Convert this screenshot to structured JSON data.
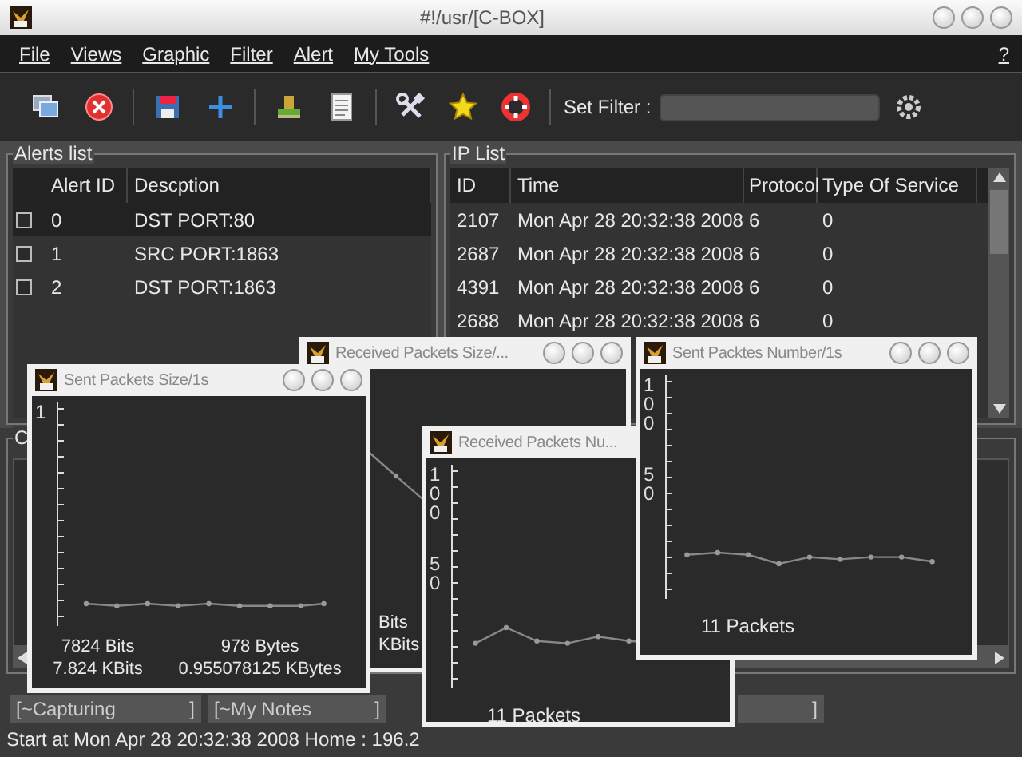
{
  "window": {
    "title": "#!/usr/[C-BOX]"
  },
  "menu": [
    {
      "label": "File"
    },
    {
      "label": "Views"
    },
    {
      "label": "Graphic"
    },
    {
      "label": "Filter"
    },
    {
      "label": "Alert"
    },
    {
      "label": "My Tools"
    }
  ],
  "help": "?",
  "toolbar": {
    "filter_label": "Set Filter :"
  },
  "alerts_list": {
    "title": "Alerts list",
    "columns": [
      "Alert ID",
      "Descption"
    ],
    "rows": [
      {
        "id": "0",
        "description": "DST PORT:80",
        "checked": false,
        "selected": true
      },
      {
        "id": "1",
        "description": "SRC PORT:1863",
        "checked": false,
        "selected": false
      },
      {
        "id": "2",
        "description": "DST PORT:1863",
        "checked": false,
        "selected": false
      }
    ]
  },
  "ip_list": {
    "title": "IP List",
    "columns": [
      "ID",
      "Time",
      "Protocol",
      "Type Of Service"
    ],
    "rows": [
      [
        "2107",
        "Mon Apr 28 20:32:38 2008",
        "6",
        "0"
      ],
      [
        "2687",
        "Mon Apr 28 20:32:38 2008",
        "6",
        "0"
      ],
      [
        "4391",
        "Mon Apr 28 20:32:38 2008",
        "6",
        "0"
      ],
      [
        "2688",
        "Mon Apr 28 20:32:38 2008",
        "6",
        "0"
      ]
    ]
  },
  "lower_panel": {
    "title": "C"
  },
  "status_fields": [
    {
      "value": "[~Capturing",
      "end": "]"
    },
    {
      "value": "[~My Notes",
      "end": "]"
    },
    {
      "end": "]"
    }
  ],
  "status_text": "Start at Mon Apr 28 20:32:38 2008 Home : 196.2",
  "graph_windows": [
    {
      "title": "Received Packets Size/...",
      "readouts": [
        "Bits",
        "KBits"
      ]
    },
    {
      "title": "Sent Packets Size/1s",
      "y_labels": [
        "1"
      ],
      "readouts": [
        "7824 Bits",
        "978 Bytes",
        "7.824 KBits",
        "0.955078125 KBytes"
      ]
    },
    {
      "title": "Received Packets Nu...",
      "y_labels": [
        "100",
        "50"
      ],
      "readouts": [
        "11 Packets"
      ]
    },
    {
      "title": "Sent Packtes Number/1s",
      "y_labels": [
        "100",
        "50"
      ],
      "readouts": [
        "11 Packets"
      ]
    }
  ]
}
